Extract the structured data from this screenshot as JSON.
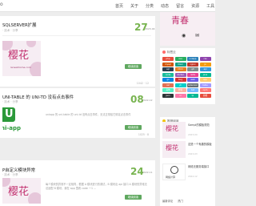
{
  "header": {
    "logo_text": "o",
    "nav": [
      "首页",
      "关于",
      "分类",
      "动态",
      "留言",
      "资源",
      "工具"
    ]
  },
  "posts": [
    {
      "title": "SQLSERVER扩展",
      "meta": "· 技术 · 分享",
      "day": "27",
      "ym": "2023-04",
      "more": "继续阅读"
    },
    {
      "thumb_hanzi": "樱花",
      "thumb_domain": "lansebhome.com",
      "more": "继续阅读",
      "foot": "1042  ·  12"
    },
    {
      "title": "UNI-TABLE 的 UNI-TD 没有点击事件",
      "meta": "· 技术 · 分享",
      "day": "08",
      "ym": "2022-12",
      "excerpt": "uniapp 的 uni-table 的 uni-td 没有点击事件，无法正常给它绑定点击事件",
      "more": "继续阅读",
      "foot": "1025  ·  8",
      "thumb_brand": "ni-app",
      "thumb_letter": "U"
    },
    {
      "title": "P自定义模块异常",
      "meta": "· 技术 · 分享",
      "day": "24",
      "ym": "2022-11",
      "excerpt": "每个模块的异常不一定相同，根据 A 模块进行的调试，B 模块出 api 接口 A 模块的异常无法适配 B 模块，我在 app 里看 code 一1 ...",
      "more": "继续阅读",
      "foot": "1071  ·  9",
      "thumb_hanzi": "樱花"
    }
  ],
  "sidebar": {
    "banner_hanzi": "青春",
    "tags_heading": "标签云",
    "tags": [
      {
        "label": "php",
        "color": "#e74c3c"
      },
      {
        "label": "vue",
        "color": "#27ae60"
      },
      {
        "label": "uniapp",
        "color": "#2980b9"
      },
      {
        "label": "css",
        "color": "#8e44ad"
      },
      {
        "label": "mysql",
        "color": "#d35400"
      },
      {
        "label": "linux",
        "color": "#16a085"
      },
      {
        "label": "nginx",
        "color": "#c0392b"
      },
      {
        "label": "js",
        "color": "#f39c12"
      },
      {
        "label": "sql",
        "color": "#2c3e50"
      },
      {
        "label": "html",
        "color": "#e67e22"
      },
      {
        "label": "git",
        "color": "#7f8c8d"
      },
      {
        "label": "api",
        "color": "#3498db"
      },
      {
        "label": "node",
        "color": "#1abc9c"
      },
      {
        "label": "docker",
        "color": "#9b59b6"
      },
      {
        "label": "redis",
        "color": "#e84393"
      },
      {
        "label": "java",
        "color": "#00b894"
      },
      {
        "label": "go",
        "color": "#0984e3"
      },
      {
        "label": "bug",
        "color": "#d63031"
      },
      {
        "label": "web",
        "color": "#6c5ce7"
      },
      {
        "label": "app",
        "color": "#fdcb6e"
      },
      {
        "label": "ssl",
        "color": "#e17055"
      },
      {
        "label": "yii",
        "color": "#00cec9"
      },
      {
        "label": "sqlserver",
        "color": "#636e72"
      },
      {
        "label": "table",
        "color": "#a29bfe"
      },
      {
        "label": "其他",
        "color": "#55efc4"
      },
      {
        "label": "经验",
        "color": "#fab1a0"
      },
      {
        "label": "bat",
        "color": "#74b9ff"
      },
      {
        "label": "npm",
        "color": "#ff7675"
      },
      {
        "label": "json",
        "color": "#2d3436"
      },
      {
        "label": "ui",
        "color": "#fd79a8"
      },
      {
        "label": "tp",
        "color": "#00b894"
      },
      {
        "label": "前端",
        "color": "#e74c3c"
      }
    ],
    "recommend_heading": "推荐阅读",
    "recommended": [
      {
        "title": "Sampl的模板规范",
        "sub": "2023-04",
        "hanzi": "樱花"
      },
      {
        "title": "这是一个有趣的模板",
        "sub": "2023-03",
        "hanzi": "樱花"
      },
      {
        "title": "网络无服务端接口",
        "sub": "2022-12",
        "mark_text": "网络计算"
      }
    ],
    "bottom_tabs": [
      "最新评论",
      "热门"
    ]
  }
}
